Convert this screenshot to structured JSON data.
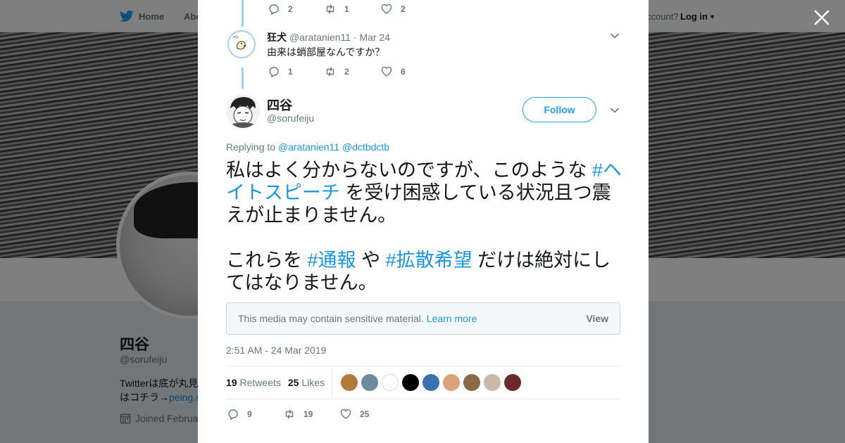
{
  "topnav": {
    "home_label": "Home",
    "about_label": "Abo",
    "have_account": "ccount?",
    "login_label": "Log in"
  },
  "profile": {
    "name": "四谷",
    "handle": "@sorufeiju",
    "bio_line1": "Twitterは底が丸見",
    "bio_line2_prefix": "はコチラ→",
    "bio_link": "peing.r",
    "joined": "Joined Februa"
  },
  "reply_above": {
    "replies": "2",
    "retweets": "1",
    "likes": "2"
  },
  "reply": {
    "name": "狂犬",
    "handle": "@aratanien11",
    "sep": "·",
    "date": "Mar 24",
    "text": "由来は蛸部屋なんですか？",
    "replies": "1",
    "retweets": "2",
    "likes": "6"
  },
  "tweet": {
    "name": "四谷",
    "handle": "@sorufeiju",
    "follow_label": "Follow",
    "replying_prefix": "Replying to",
    "mention1": "@aratanien11",
    "mention2": "@dctbdctb",
    "text_part1": "私はよく分からないのですが、このような",
    "tag1": "#ヘイトスピーチ",
    "text_part2": "を受け困惑している状況且つ震えが止まりません。",
    "text_part3": "これらを",
    "tag2": "#通報",
    "text_part4": "や",
    "tag3": "#拡散希望",
    "text_part5": "だけは絶対にしてはなりません。",
    "sensitive_text": "This media may contain sensitive material.",
    "learn_more": "Learn more",
    "view_label": "View",
    "timestamp": "2:51 AM - 24 Mar 2019",
    "retweet_count": "19",
    "retweet_label": "Retweets",
    "like_count": "25",
    "like_label": "Likes",
    "replies": "9",
    "retweets": "19",
    "likes": "25"
  },
  "liker_colors": [
    "#b07a3b",
    "#6d8aa0",
    "#ffffff",
    "#000000",
    "#3a6fb0",
    "#d9a27a",
    "#8a6a4a",
    "#c9b9a8",
    "#6a2a2a"
  ],
  "colors": {
    "accent": "#1da1f2",
    "link": "#1b95e0",
    "muted": "#657786",
    "reply_thread": "#9fd0f5"
  }
}
